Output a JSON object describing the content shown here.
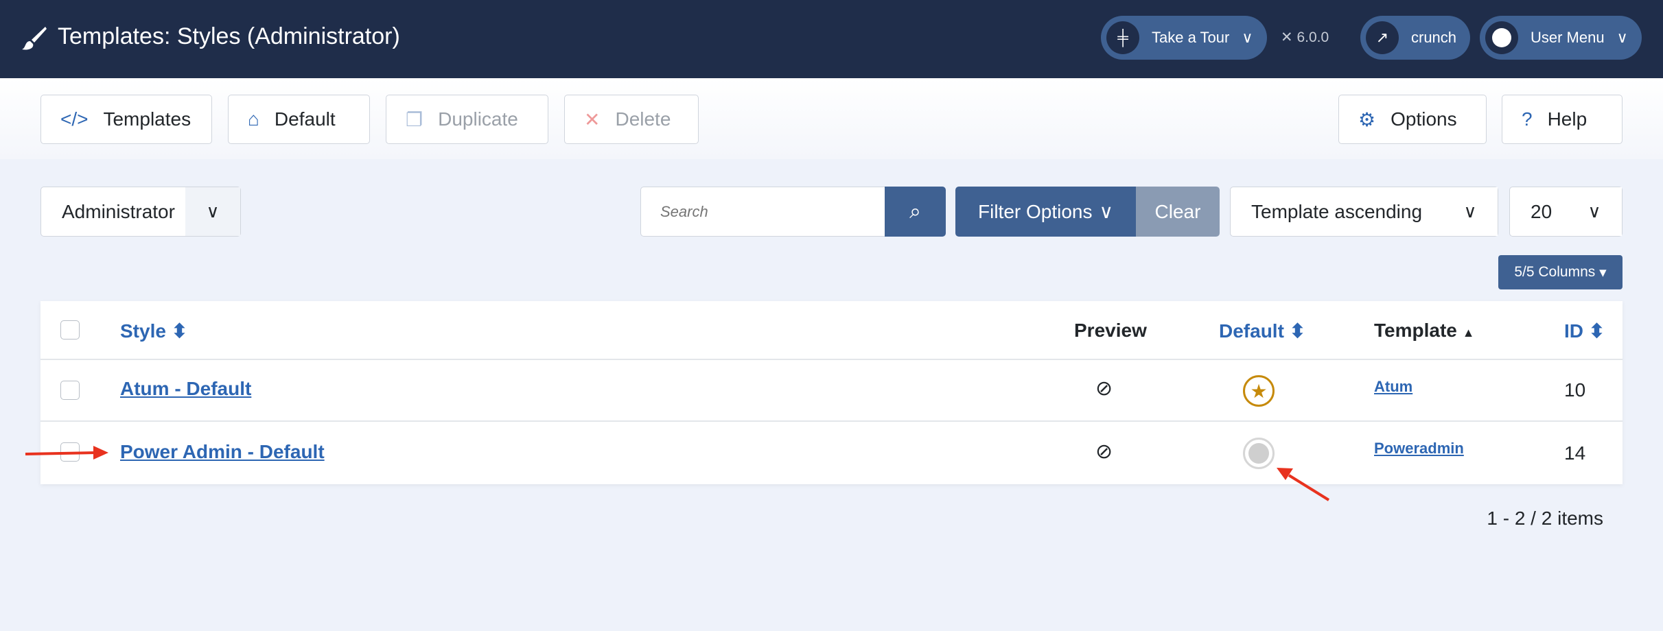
{
  "header": {
    "title": "Templates: Styles (Administrator)",
    "tour": "Take a Tour",
    "version": "6.0.0",
    "site": "crunch",
    "user_menu": "User Menu"
  },
  "toolbar": {
    "templates": "Templates",
    "default": "Default",
    "duplicate": "Duplicate",
    "delete": "Delete",
    "options": "Options",
    "help": "Help"
  },
  "filters": {
    "client": "Administrator",
    "search_placeholder": "Search",
    "filter_options": "Filter Options",
    "clear": "Clear",
    "sort": "Template ascending",
    "limit": "20",
    "columns": "5/5 Columns"
  },
  "table": {
    "headers": {
      "style": "Style",
      "preview": "Preview",
      "default": "Default",
      "template": "Template",
      "id": "ID"
    },
    "rows": [
      {
        "style": "Atum - Default",
        "template": "Atum",
        "id": "10",
        "is_default": true
      },
      {
        "style": "Power Admin - Default",
        "template": "Poweradmin",
        "id": "14",
        "is_default": false
      }
    ]
  },
  "pagination": "1 - 2 / 2 items",
  "colors": {
    "header": "#1f2d4a",
    "accent": "#3f6192",
    "link": "#2d66b3",
    "star": "#c68a0b",
    "annotation": "#e8321e"
  }
}
